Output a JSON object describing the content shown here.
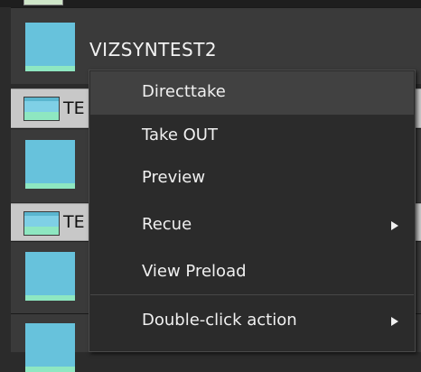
{
  "rows": [
    {
      "name": "VIZSYNTEST2"
    },
    {
      "name": "TE"
    },
    {
      "name": "TE"
    }
  ],
  "context_menu": {
    "items": [
      {
        "label": "Directtake",
        "highlighted": true,
        "submenu": false
      },
      {
        "label": "Take OUT",
        "submenu": false
      },
      {
        "label": "Preview",
        "submenu": false
      },
      {
        "label": "Recue",
        "submenu": true
      },
      {
        "label": "View Preload",
        "submenu": false
      },
      {
        "label": "Double-click action",
        "submenu": true
      }
    ]
  },
  "colors": {
    "background": "#2b2b2b",
    "thumbnail": "#67c2dc",
    "thumbnail_bottom": "#8ee7c1",
    "selected_row": "#c8c8c8",
    "menu_highlight": "#414141"
  }
}
